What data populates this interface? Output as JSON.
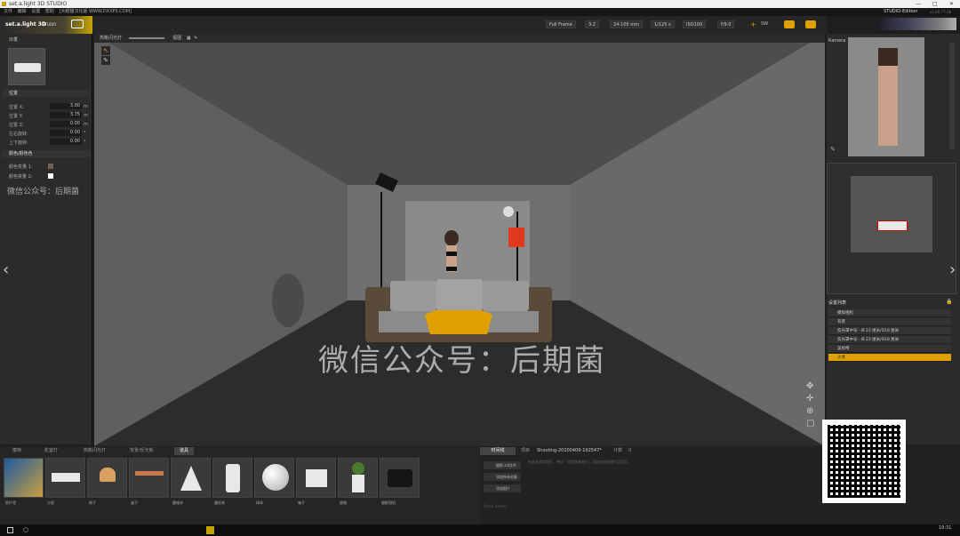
{
  "window": {
    "title": "set.a.light 3D STUDIO"
  },
  "menu": {
    "items": [
      "文件",
      "编辑",
      "设置",
      "帮助"
    ],
    "extra": "[大眼猫汉化版  WWW.DXXPS.COM]"
  },
  "logo": {
    "text": "set.a.light 3D",
    "badge": "STUDIO"
  },
  "edition": {
    "label": "STUDIO-Edition",
    "version": "v1.00.77-2b"
  },
  "toolbar": {
    "frame": "Full Frame",
    "ratio": "3:2",
    "lens": "24-105 mm",
    "shutter": "1/125 s",
    "iso": "ISO100",
    "aperture": "f/9.0",
    "sw": "SW"
  },
  "viewport_toolbar": {
    "flash_label": "热靴闪光灯",
    "view_label": "视图"
  },
  "left_panel": {
    "object_title": "沙发",
    "position_header": "位置",
    "props": [
      {
        "label": "位置 X:",
        "value": "3.00",
        "unit": "m"
      },
      {
        "label": "位置 Y:",
        "value": "3.75",
        "unit": "m"
      },
      {
        "label": "位置 Z:",
        "value": "0.00",
        "unit": "m"
      },
      {
        "label": "左右旋转:",
        "value": "0.00",
        "unit": "°"
      },
      {
        "label": "上下旋转:",
        "value": "0.00",
        "unit": "°"
      }
    ],
    "color_header": "颜色/颜色色",
    "colors": [
      {
        "label": "颜色变量 1:",
        "swatch": "#7a6050"
      },
      {
        "label": "颜色变量 2:",
        "swatch": "#ffffff"
      }
    ],
    "watermark": "微信公众号：后期菌"
  },
  "right_panel": {
    "camera_label": "Kamera",
    "list_header": "设置列表",
    "list": [
      {
        "label": "模拟相机",
        "selected": false
      },
      {
        "label": "背景",
        "selected": false
      },
      {
        "label": "反光罩中号 - Ø 23 厘米/D18 厘米",
        "selected": false
      },
      {
        "label": "反光罩中号 - Ø 23 厘米/D18 厘米",
        "selected": false
      },
      {
        "label": "美妆椅",
        "selected": false
      },
      {
        "label": "沙发",
        "selected": true
      }
    ]
  },
  "bottom_tabs": {
    "items": [
      "模特",
      "影室灯",
      "热靴闪光灯",
      "背景/反光板",
      "道具"
    ],
    "active": "道具"
  },
  "props_library": [
    {
      "label": "照片墙"
    },
    {
      "label": "沙发"
    },
    {
      "label": "椅子"
    },
    {
      "label": "桌子"
    },
    {
      "label": "圆锥体"
    },
    {
      "label": "圆柱体"
    },
    {
      "label": "球体"
    },
    {
      "label": "箱子"
    },
    {
      "label": "植物"
    },
    {
      "label": "摄影相机"
    }
  ],
  "timeline": {
    "tab_label": "时间线",
    "project_label": "项目",
    "project_name": "Shooting-20200409-192547*",
    "count_label": "计数",
    "count_value": "0",
    "buttons": [
      "摄影.sdl文件",
      "添加所有创意",
      "添加照片"
    ],
    "hint": "在此处添加照片，单击「添加所有照片」添加对应的图片至设定。",
    "footer": "Photo Viewer"
  },
  "viewport_watermark": "微信公众号：后期菌",
  "taskbar": {
    "time": "19:31"
  },
  "colors": {
    "accent": "#e0a000",
    "reflector": "#e03a1e"
  }
}
